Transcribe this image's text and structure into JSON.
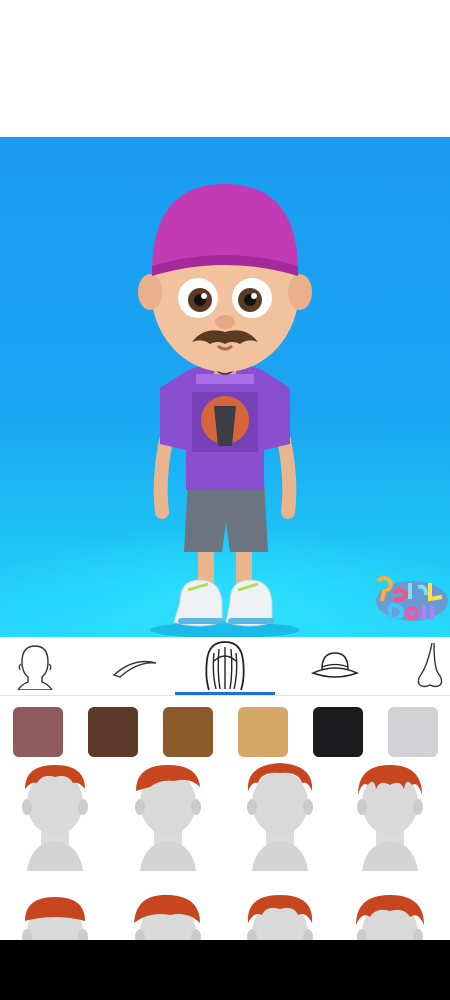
{
  "app": {
    "brand_logo_text": [
      "Perfect",
      "Doll"
    ]
  },
  "tabs": [
    {
      "id": "face",
      "icon": "face-outline-icon",
      "selected": false
    },
    {
      "id": "eyebrows",
      "icon": "eyebrow-icon",
      "selected": false
    },
    {
      "id": "hair",
      "icon": "hair-icon",
      "selected": true
    },
    {
      "id": "hats",
      "icon": "hat-icon",
      "selected": false
    },
    {
      "id": "nose",
      "icon": "nose-icon",
      "selected": false
    }
  ],
  "colors": {
    "stage_top": "#1a9cf1",
    "stage_floor": "#28d9fb",
    "indicator": "#1f6fd6",
    "hair_preview": "#c8461f",
    "swatches": [
      "#8e5c5c",
      "#5b3a2a",
      "#8c5a2b",
      "#d6a866",
      "#1c1c1e",
      "#d2d2d6"
    ]
  },
  "hair_styles": [
    {
      "id": 1,
      "icon": "hair-style-short-spiky-icon"
    },
    {
      "id": 2,
      "icon": "hair-style-swept-icon"
    },
    {
      "id": 3,
      "icon": "hair-style-messy-icon"
    },
    {
      "id": 4,
      "icon": "hair-style-fringe-icon"
    },
    {
      "id": 5,
      "icon": "hair-style-bowl-icon"
    },
    {
      "id": 6,
      "icon": "hair-style-quiff-icon"
    },
    {
      "id": 7,
      "icon": "hair-style-curly-icon"
    },
    {
      "id": 8,
      "icon": "hair-style-textured-icon"
    }
  ]
}
